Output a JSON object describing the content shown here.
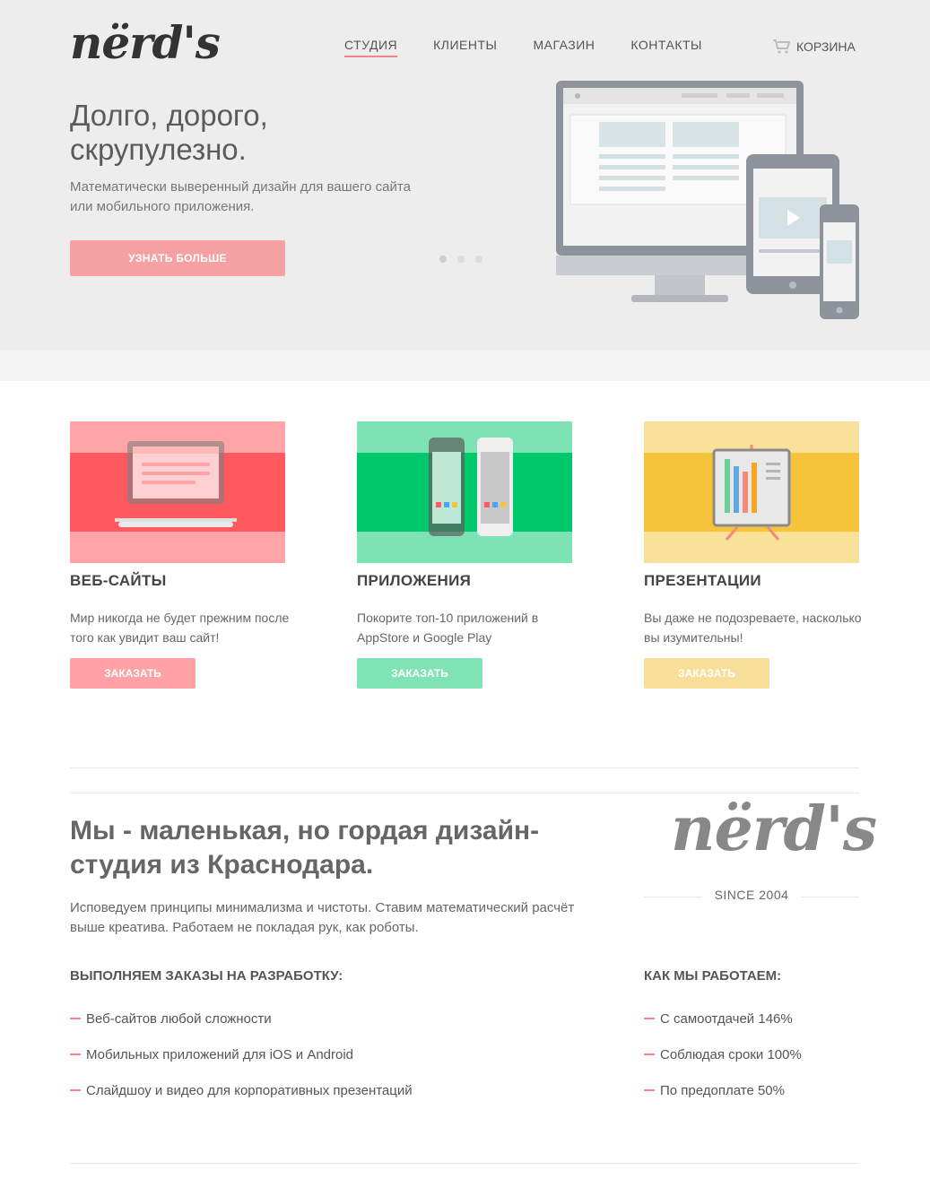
{
  "brand": {
    "logo_text": "nërd's"
  },
  "nav": {
    "items": [
      {
        "label": "Студия"
      },
      {
        "label": "Клиенты"
      },
      {
        "label": "Магазин"
      },
      {
        "label": "Контакты"
      }
    ],
    "cart_label": "Корзина"
  },
  "hero": {
    "title": "Долго, дорого, скрупулезно.",
    "subtitle": "Математически выверенный дизайн для вашего сайта или мобильного приложения.",
    "cta_label": "Узнать больше",
    "slides_total": 3,
    "active_slide": 1
  },
  "services": [
    {
      "title": "Веб-сайты",
      "text": "Мир никогда не будет прежним после того как увидит ваш сайт!",
      "button": "Заказать",
      "color": "#ff5a5f"
    },
    {
      "title": "Приложения",
      "text": "Покорите топ-10 приложений в AppStore и Google Play",
      "button": "Заказать",
      "color": "#00c96b"
    },
    {
      "title": "Презентации",
      "text": "Вы даже не подозреваете, насколько вы изумительны!",
      "button": "Заказать",
      "color": "#f5c43a"
    }
  ],
  "about": {
    "title": "Мы - маленькая, но гордая дизайн-студия из Краснодара.",
    "text": "Исповедуем принципы минимализма и чистоты. Ставим математический расчёт выше креатива. Работаем не покладая рук, как роботы.",
    "since": "SINCE 2004",
    "orders_heading": "Выполняем заказы на разработку:",
    "orders": [
      "Веб-сайтов любой сложности",
      "Мобильных приложений для iOS и Android",
      "Слайдшоу и видео для корпоративных презентаций"
    ],
    "how_heading": "Как мы работаем:",
    "how": [
      "С самоотдачей 146%",
      "Соблюдая сроки 100%",
      "По предоплате 50%"
    ]
  },
  "colors": {
    "accent": "#f2858c",
    "hero_bg": "#ededed"
  }
}
